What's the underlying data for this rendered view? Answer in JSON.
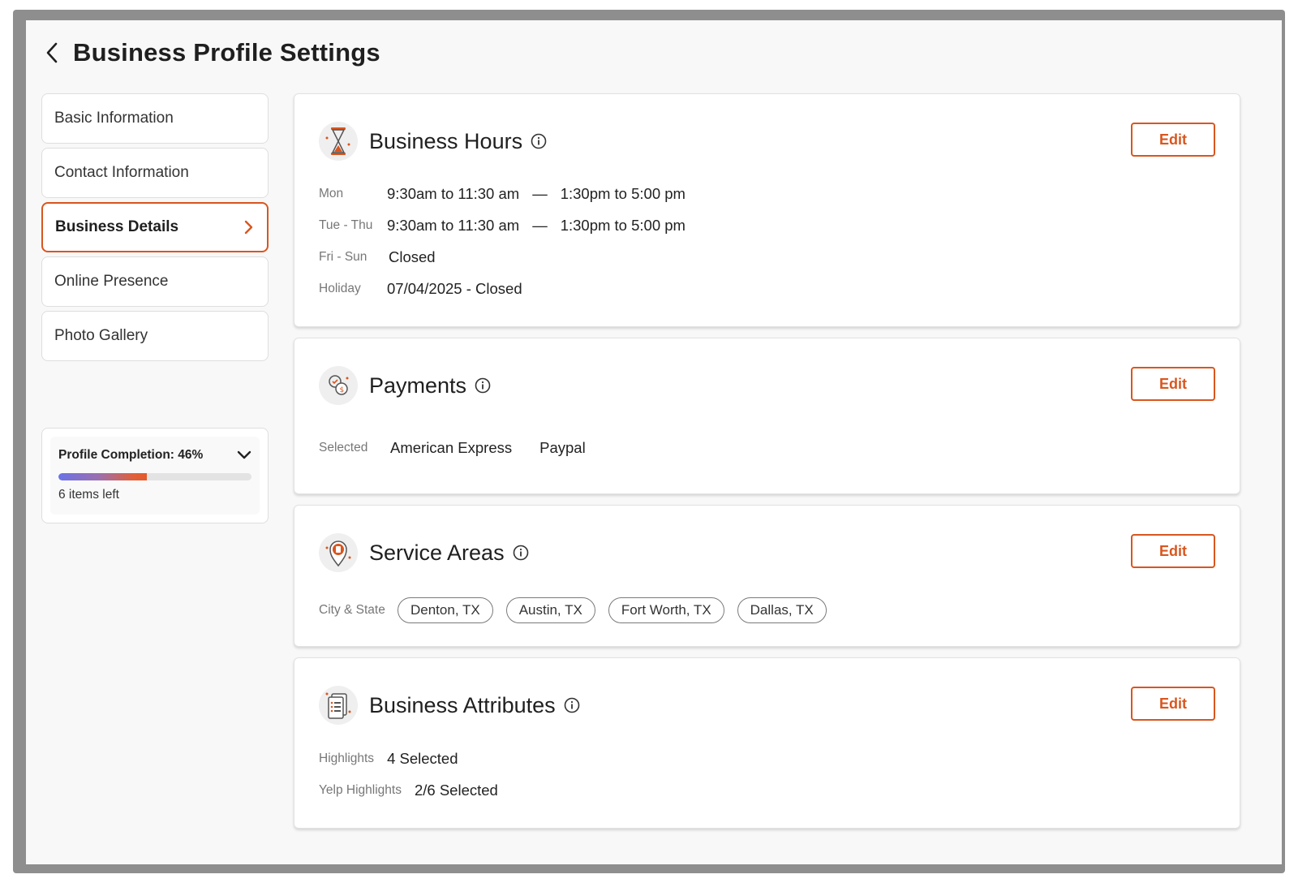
{
  "page": {
    "title": "Business Profile Settings"
  },
  "nav": {
    "items": [
      {
        "label": "Basic Information"
      },
      {
        "label": "Contact Information"
      },
      {
        "label": "Business Details"
      },
      {
        "label": "Online Presence"
      },
      {
        "label": "Photo Gallery"
      }
    ],
    "active_index": 2
  },
  "profile_completion": {
    "label": "Profile Completion: 46%",
    "percent": 46,
    "items_left": "6 items left"
  },
  "business_hours": {
    "title": "Business Hours",
    "edit_label": "Edit",
    "rows": [
      {
        "day": "Mon",
        "morning": "9:30am to 11:30 am",
        "sep": "—",
        "afternoon": "1:30pm to 5:00 pm"
      },
      {
        "day": "Tue - Thu",
        "morning": "9:30am to 11:30 am",
        "sep": "—",
        "afternoon": "1:30pm to 5:00 pm"
      },
      {
        "day": "Fri - Sun",
        "value": "Closed"
      },
      {
        "day": "Holiday",
        "value": "07/04/2025 - Closed"
      }
    ]
  },
  "payments": {
    "title": "Payments",
    "edit_label": "Edit",
    "label": "Selected",
    "methods": [
      "American Express",
      "Paypal"
    ]
  },
  "service_areas": {
    "title": "Service Areas",
    "edit_label": "Edit",
    "label": "City & State",
    "areas": [
      "Denton, TX",
      "Austin, TX",
      "Fort Worth, TX",
      "Dallas, TX"
    ]
  },
  "business_attributes": {
    "title": "Business Attributes",
    "edit_label": "Edit",
    "rows": [
      {
        "label": "Highlights",
        "value": "4 Selected"
      },
      {
        "label": "Yelp Highlights",
        "value": "2/6 Selected"
      }
    ]
  },
  "colors": {
    "accent": "#d9561f",
    "progress_start": "#6a72e6",
    "progress_end": "#e45a2a"
  }
}
